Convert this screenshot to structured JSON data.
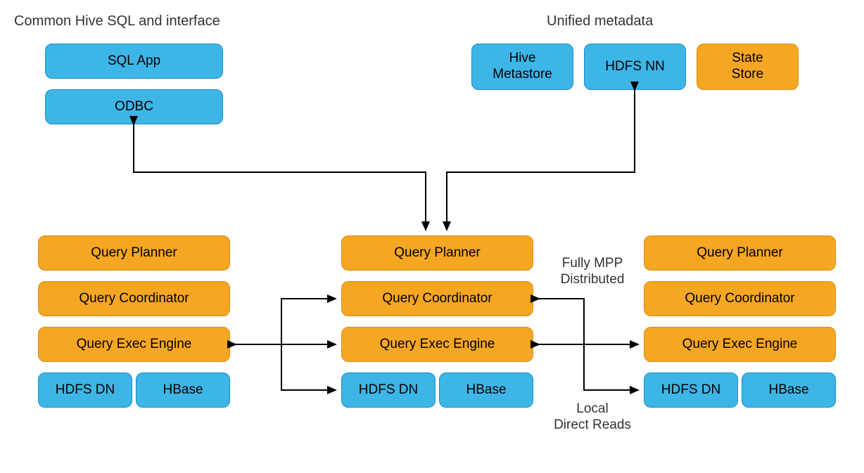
{
  "headings": {
    "left": "Common Hive SQL and interface",
    "right": "Unified metadata"
  },
  "topLeft": {
    "sqlApp": "SQL App",
    "odbc": "ODBC"
  },
  "topRight": {
    "hiveMetastore": "Hive\nMetastore",
    "hdfsNN": "HDFS NN",
    "stateStore": "State\nStore"
  },
  "node": {
    "planner": "Query Planner",
    "coord": "Query Coordinator",
    "exec": "Query Exec Engine",
    "hdfsDN": "HDFS DN",
    "hbase": "HBase"
  },
  "annotations": {
    "mpp": "Fully MPP\nDistributed",
    "local": "Local\nDirect Reads"
  },
  "colors": {
    "blue": "#3db5e6",
    "orange": "#f5a623"
  }
}
